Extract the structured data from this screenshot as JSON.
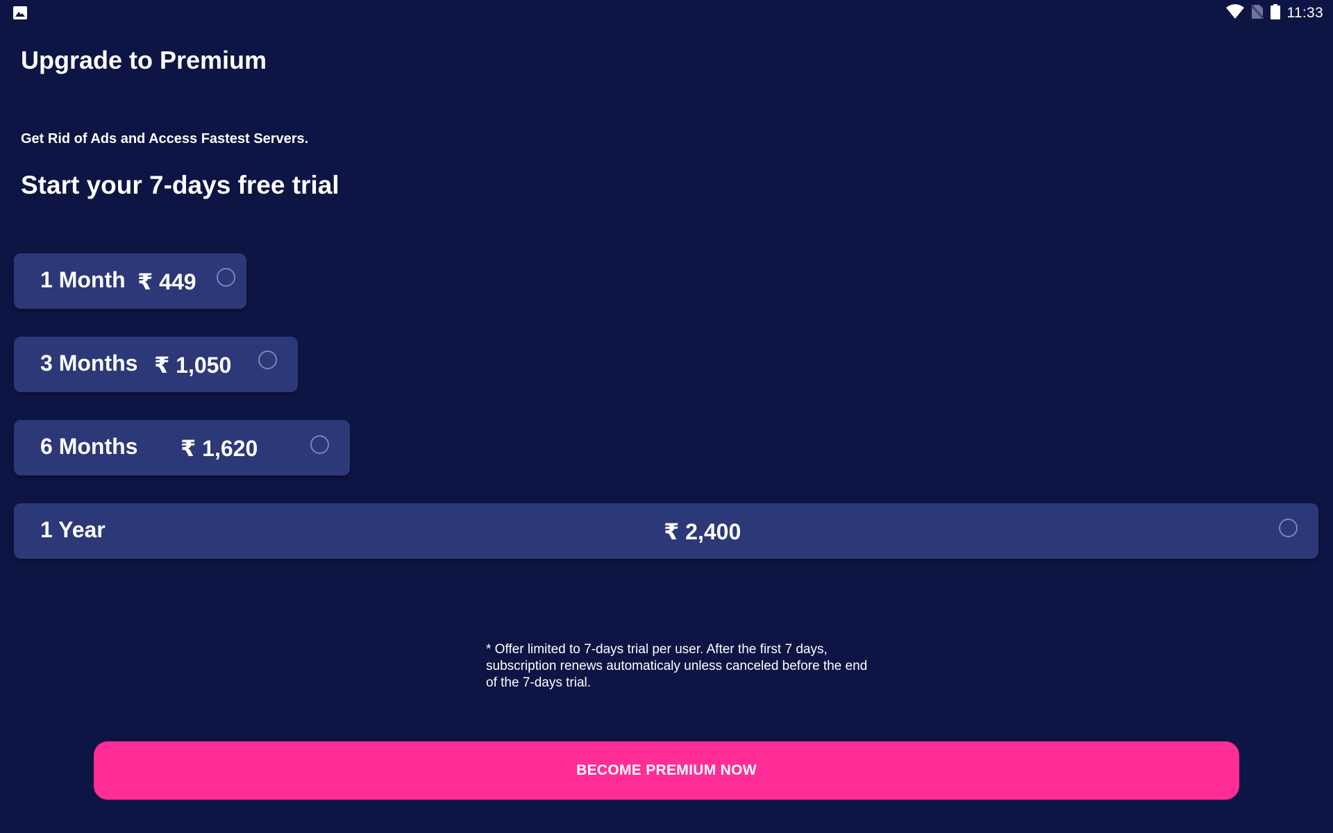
{
  "status_bar": {
    "left_icon": "gallery-notification-icon",
    "icons": [
      "wifi-icon",
      "no-sim-icon",
      "battery-icon"
    ],
    "time": "11:33"
  },
  "header": {
    "title": "Upgrade to Premium",
    "subtitle": "Get Rid of Ads and Access Fastest Servers.",
    "trial_heading": "Start your 7-days free trial"
  },
  "plans": [
    {
      "name": "1 Month",
      "price": "₹ 449",
      "selected": false
    },
    {
      "name": "3 Months",
      "price": "₹ 1,050",
      "selected": false
    },
    {
      "name": "6 Months",
      "price": "₹ 1,620",
      "selected": false
    },
    {
      "name": "1 Year",
      "price": "₹ 2,400",
      "selected": false
    }
  ],
  "disclaimer": "* Offer limited to 7-days trial per user. After the first 7 days, subscription renews automaticaly unless canceled before the end of the 7-days trial.",
  "cta": {
    "label": "BECOME PREMIUM NOW"
  },
  "colors": {
    "background": "#0d1544",
    "plan_card": "#2c3878",
    "cta": "#ff2d95",
    "radio_border": "#7c86b4"
  }
}
